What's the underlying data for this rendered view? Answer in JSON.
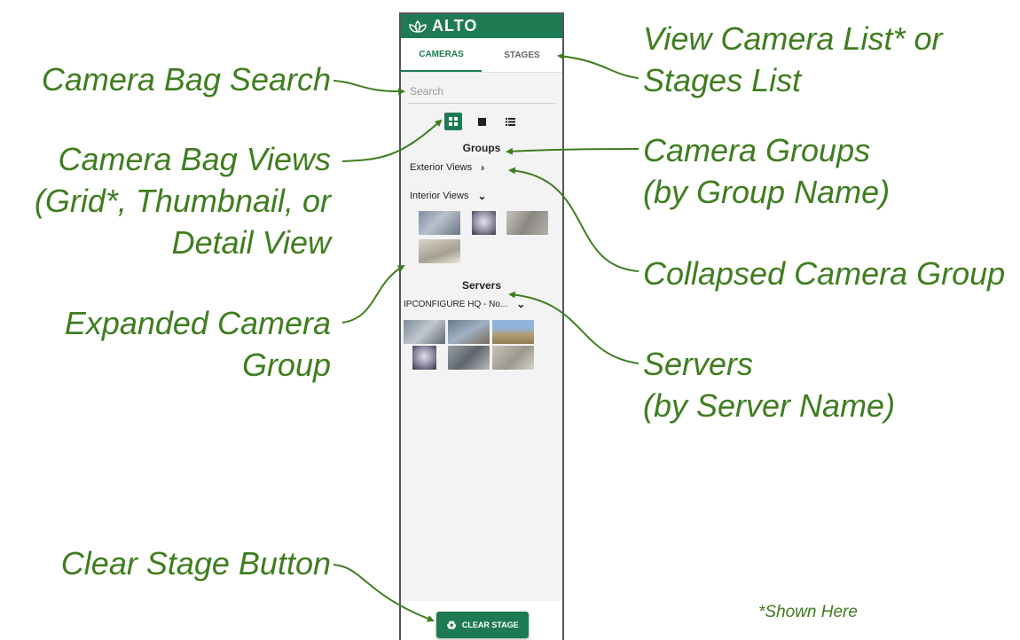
{
  "app": {
    "logo_text": "ALTO",
    "colors": {
      "brand": "#1e7a52",
      "annotation": "#3f7d1f"
    }
  },
  "tabs": [
    {
      "label": "CAMERAS",
      "active": true
    },
    {
      "label": "STAGES",
      "active": false
    }
  ],
  "search": {
    "placeholder": "Search",
    "value": ""
  },
  "view_toggles": [
    {
      "icon": "grid-view-icon",
      "active": true
    },
    {
      "icon": "thumbnail-view-icon",
      "active": false
    },
    {
      "icon": "detail-view-icon",
      "active": false
    }
  ],
  "groups": {
    "title": "Groups",
    "items": [
      {
        "label": "Exterior Views",
        "expanded": false,
        "chevron": "chevron-right-icon"
      },
      {
        "label": "Interior Views",
        "expanded": true,
        "chevron": "chevron-down-icon",
        "camera_count": 4
      }
    ]
  },
  "servers": {
    "title": "Servers",
    "items": [
      {
        "label": "IPCONFIGURE HQ - No...",
        "expanded": true,
        "chevron": "chevron-down-icon",
        "camera_count": 6
      }
    ]
  },
  "clear_stage": {
    "label": "CLEAR STAGE",
    "icon": "recycle-icon"
  },
  "annotations": {
    "camera_bag_search": "Camera Bag Search",
    "camera_bag_views": [
      "Camera Bag Views",
      "(Grid*, Thumbnail, or",
      "Detail View"
    ],
    "expanded_group": [
      "Expanded Camera",
      "Group"
    ],
    "clear_stage_button": "Clear Stage Button",
    "view_list": [
      "View Camera List* or",
      "Stages List"
    ],
    "camera_groups": [
      "Camera Groups",
      "(by Group Name)"
    ],
    "collapsed_group": "Collapsed Camera Group",
    "servers": [
      "Servers",
      "(by Server Name)"
    ],
    "shown_here": "*Shown Here"
  }
}
